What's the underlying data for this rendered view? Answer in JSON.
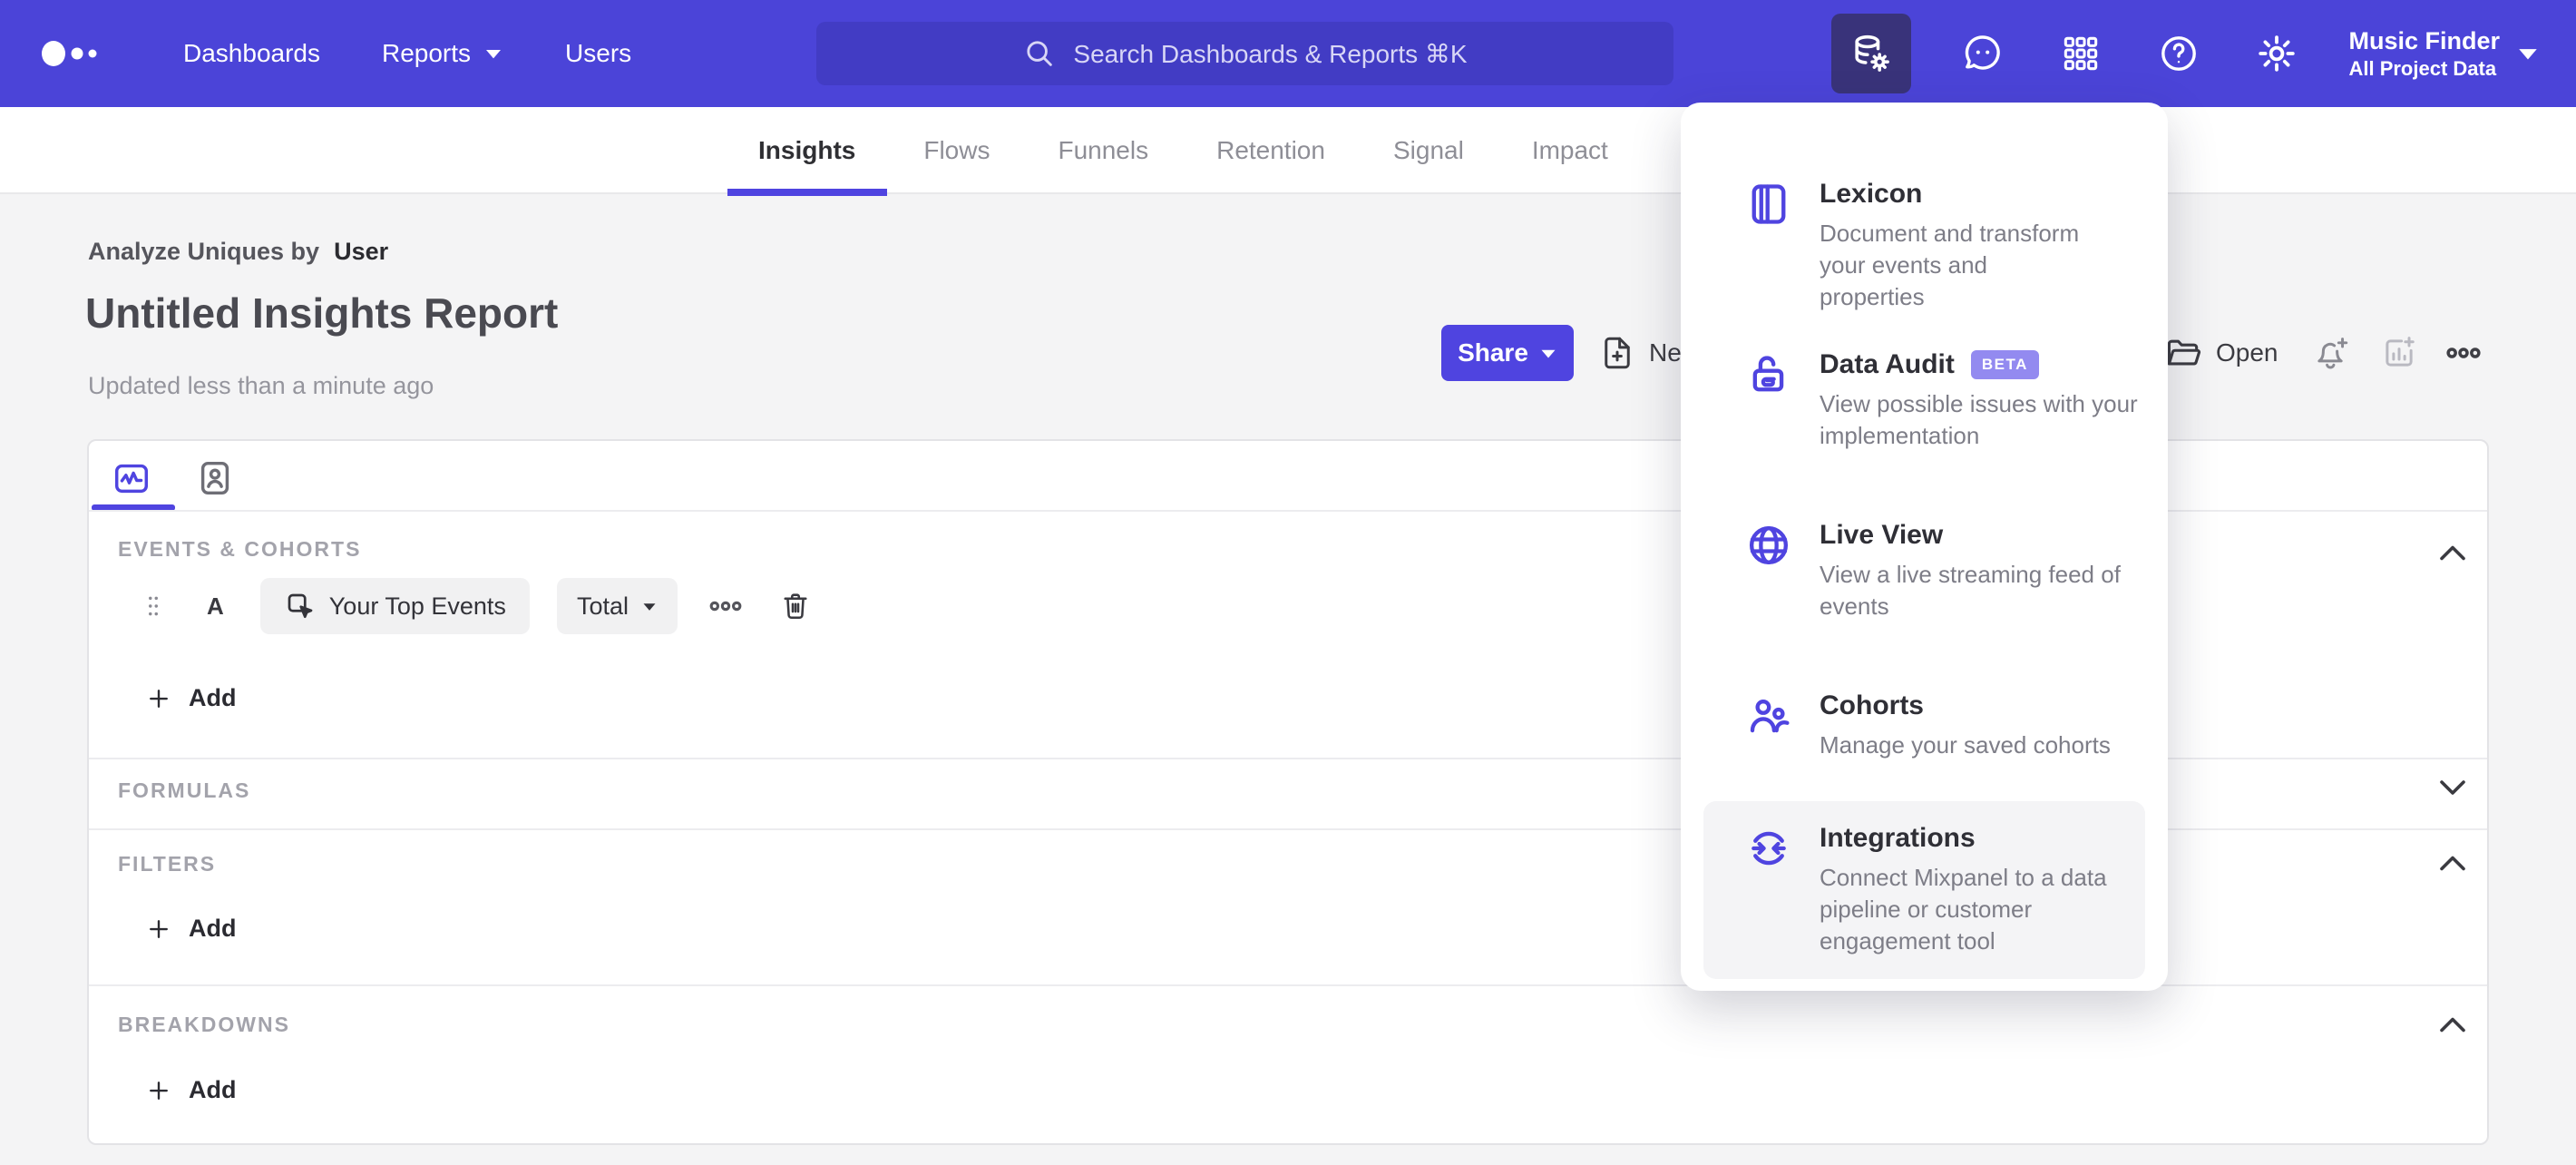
{
  "colors": {
    "accent": "#4f44e0",
    "nav_bg": "#4b44d8",
    "nav_active_icon_bg": "#39337a",
    "search_bg": "#423cc4",
    "beta_badge_bg": "#938af0",
    "page_bg": "#f4f4f5"
  },
  "nav": {
    "items": [
      {
        "label": "Dashboards"
      },
      {
        "label": "Reports"
      },
      {
        "label": "Users"
      }
    ],
    "search": {
      "placeholder": "Search Dashboards & Reports ⌘K"
    },
    "project": {
      "name": "Music Finder",
      "scope": "All Project Data"
    }
  },
  "tabs": {
    "items": [
      {
        "label": "Insights",
        "active": true
      },
      {
        "label": "Flows",
        "active": false
      },
      {
        "label": "Funnels",
        "active": false
      },
      {
        "label": "Retention",
        "active": false
      },
      {
        "label": "Signal",
        "active": false
      },
      {
        "label": "Impact",
        "active": false
      }
    ]
  },
  "header": {
    "analyze_prefix": "Analyze Uniques by",
    "analyze_value": "User",
    "title": "Untitled Insights Report",
    "updated": "Updated less than a minute ago"
  },
  "toolbar": {
    "share_label": "Share",
    "new_label": "New",
    "open_label": "Open"
  },
  "builder": {
    "events_label": "EVENTS & COHORTS",
    "row": {
      "letter": "A",
      "event": "Your Top Events",
      "aggregation": "Total"
    },
    "add_label": "Add",
    "formulas_label": "FORMULAS",
    "filters_label": "FILTERS",
    "breakdowns_label": "BREAKDOWNS"
  },
  "menu": {
    "items": [
      {
        "title": "Lexicon",
        "desc": "Document and transform your events and properties"
      },
      {
        "title": "Data Audit",
        "badge": "BETA",
        "desc": "View possible issues with your implementation"
      },
      {
        "title": "Live View",
        "desc": "View a live streaming feed of events"
      },
      {
        "title": "Cohorts",
        "desc": "Manage your saved cohorts"
      },
      {
        "title": "Integrations",
        "desc": "Connect Mixpanel to a data pipeline or customer engagement tool",
        "highlighted": true
      }
    ]
  }
}
